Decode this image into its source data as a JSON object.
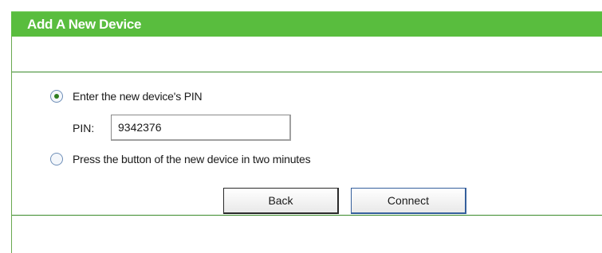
{
  "header": {
    "title": "Add A New Device"
  },
  "options": {
    "enter_pin_label": "Enter the new device's PIN",
    "push_button_label": "Press the button of the new device in two minutes",
    "selected": "enter_pin"
  },
  "pin": {
    "label": "PIN:",
    "value": "9342376"
  },
  "buttons": {
    "back_label": "Back",
    "connect_label": "Connect"
  },
  "colors": {
    "header_bg": "#59bd3e",
    "divider": "#3a8a2a"
  }
}
